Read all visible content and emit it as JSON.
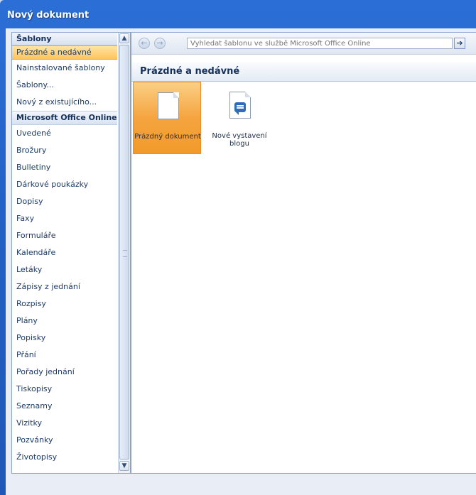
{
  "window": {
    "title": "Nový dokument"
  },
  "sidebar": {
    "items": [
      {
        "label": "Šablony",
        "kind": "header"
      },
      {
        "label": "Prázdné a nedávné",
        "kind": "selected"
      },
      {
        "label": "Nainstalované šablony",
        "kind": "item"
      },
      {
        "label": "Šablony...",
        "kind": "item"
      },
      {
        "label": "Nový z existujícího...",
        "kind": "item"
      },
      {
        "label": "Microsoft Office Online",
        "kind": "section"
      },
      {
        "label": "Uvedené",
        "kind": "item"
      },
      {
        "label": "Brožury",
        "kind": "item"
      },
      {
        "label": "Bulletiny",
        "kind": "item"
      },
      {
        "label": "Dárkové poukázky",
        "kind": "item"
      },
      {
        "label": "Dopisy",
        "kind": "item"
      },
      {
        "label": "Faxy",
        "kind": "item"
      },
      {
        "label": "Formuláře",
        "kind": "item"
      },
      {
        "label": "Kalendáře",
        "kind": "item"
      },
      {
        "label": "Letáky",
        "kind": "item"
      },
      {
        "label": "Zápisy z jednání",
        "kind": "item"
      },
      {
        "label": "Rozpisy",
        "kind": "item"
      },
      {
        "label": "Plány",
        "kind": "item"
      },
      {
        "label": "Popisky",
        "kind": "item"
      },
      {
        "label": "Přání",
        "kind": "item"
      },
      {
        "label": "Pořady jednání",
        "kind": "item"
      },
      {
        "label": "Tiskopisy",
        "kind": "item"
      },
      {
        "label": "Seznamy",
        "kind": "item"
      },
      {
        "label": "Vizitky",
        "kind": "item"
      },
      {
        "label": "Pozvánky",
        "kind": "item"
      },
      {
        "label": "Životopisy",
        "kind": "item"
      }
    ]
  },
  "toolbar": {
    "back_icon": "arrow-left-icon",
    "forward_icon": "arrow-right-icon",
    "search_placeholder": "Vyhledat šablonu ve službě Microsoft Office Online",
    "go_icon": "arrow-right-icon"
  },
  "main": {
    "section_title": "Prázdné a nedávné",
    "tiles": [
      {
        "label": "Prázdný dokument",
        "icon": "blank-document-icon",
        "selected": true
      },
      {
        "label": "Nové vystavení blogu",
        "icon": "blog-post-icon",
        "selected": false
      }
    ]
  },
  "colors": {
    "title_bar": "#2461c6",
    "selection": "#f5a43f",
    "header_text": "#15305a"
  }
}
